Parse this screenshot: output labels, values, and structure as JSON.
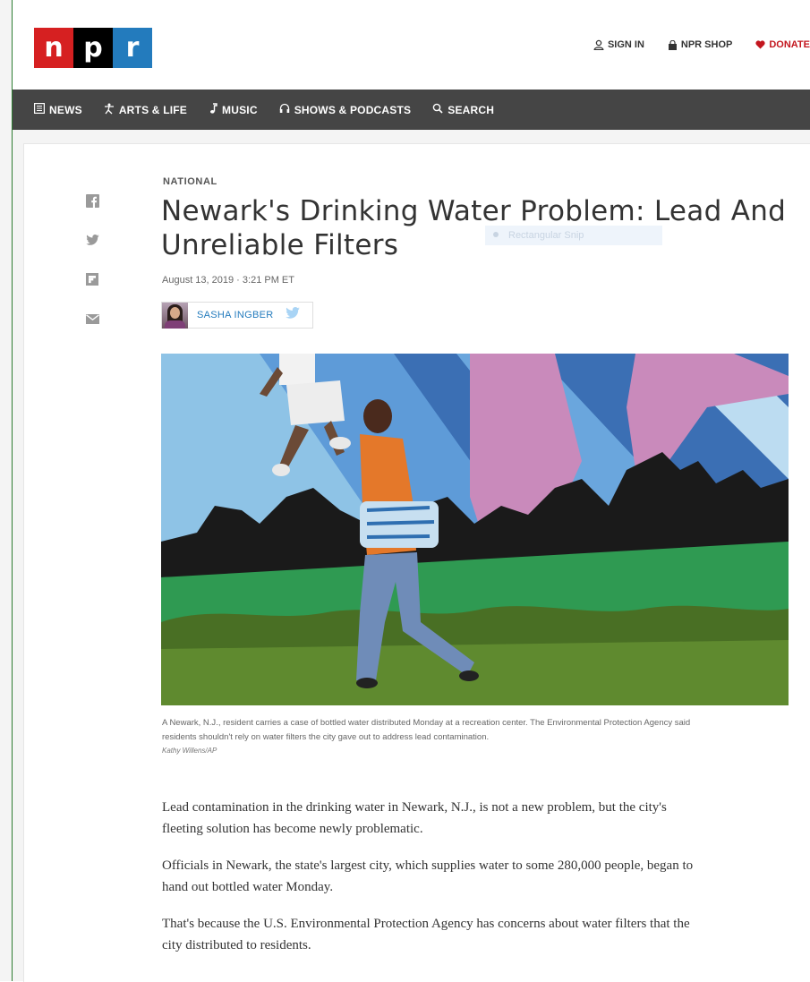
{
  "header": {
    "logo": [
      "n",
      "p",
      "r"
    ],
    "util_links": [
      {
        "label": "SIGN IN",
        "icon": "person-icon"
      },
      {
        "label": "NPR SHOP",
        "icon": "bag-icon"
      },
      {
        "label": "DONATE",
        "icon": "heart-icon"
      }
    ]
  },
  "nav": {
    "items": [
      {
        "label": "NEWS",
        "icon": "news-icon"
      },
      {
        "label": "ARTS & LIFE",
        "icon": "arts-icon"
      },
      {
        "label": "MUSIC",
        "icon": "music-note-icon"
      },
      {
        "label": "SHOWS & PODCASTS",
        "icon": "headphones-icon"
      },
      {
        "label": "SEARCH",
        "icon": "search-icon"
      }
    ]
  },
  "share": [
    "facebook-icon",
    "twitter-icon",
    "flipboard-icon",
    "email-icon"
  ],
  "article": {
    "slug": "NATIONAL",
    "title": "Newark's Drinking Water Problem: Lead And Unreliable Filters",
    "snip_overlay": "Rectangular Snip",
    "date": "August 13, 2019 · 3:21 PM ET",
    "author": "SASHA INGBER",
    "caption": "A Newark, N.J., resident carries a case of bottled water distributed Monday at a recreation center. The Environmental Protection Agency said residents shouldn't rely on water filters the city gave out to address lead contamination.",
    "credit": "Kathy Willens/AP",
    "paragraphs": [
      "Lead contamination in the drinking water in Newark, N.J., is not a new problem, but the city's fleeting solution has become newly problematic.",
      "Officials in Newark, the state's largest city, which supplies water to some 280,000 people, began to hand out bottled water Monday.",
      "That's because the U.S. Environmental Protection Agency has concerns about water filters that the city distributed to residents."
    ]
  },
  "colors": {
    "npr_red": "#d62021",
    "npr_black": "#000000",
    "npr_blue": "#237bbd",
    "nav_bg": "#454545",
    "donate": "#c3161e"
  }
}
